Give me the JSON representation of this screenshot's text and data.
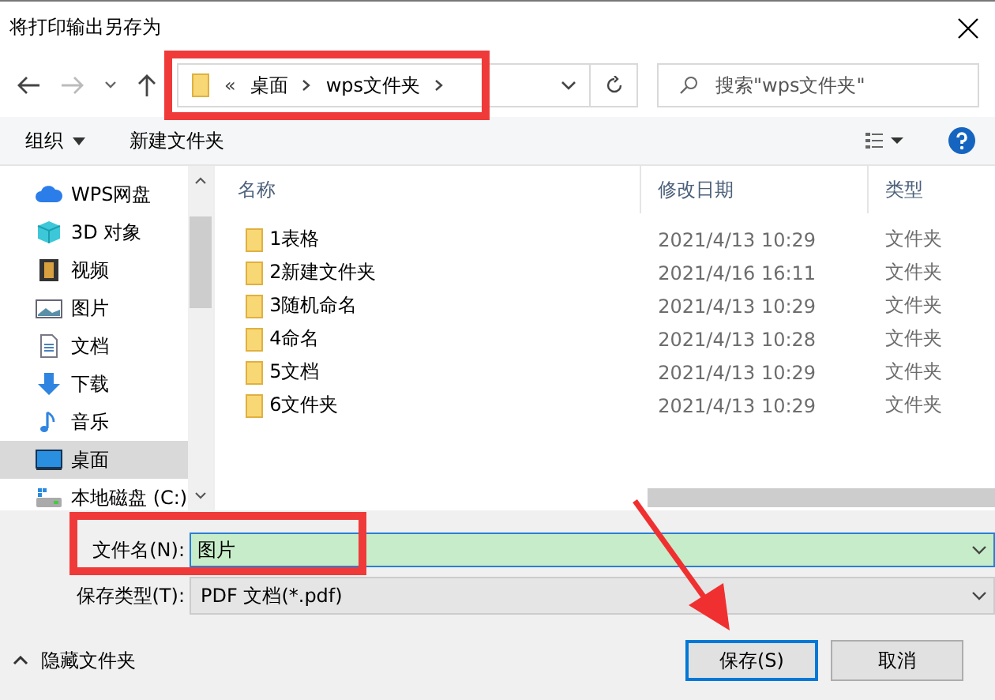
{
  "window": {
    "title": "将打印输出另存为"
  },
  "address": {
    "overflow": "«",
    "path": [
      "桌面",
      "wps文件夹"
    ]
  },
  "search": {
    "placeholder": "搜索\"wps文件夹\""
  },
  "toolbar": {
    "organize": "组织",
    "new_folder": "新建文件夹"
  },
  "sidebar": {
    "items": [
      {
        "label": "WPS网盘",
        "kind": "cloud",
        "selected": false
      },
      {
        "label": "3D 对象",
        "kind": "cube",
        "selected": false
      },
      {
        "label": "视频",
        "kind": "video",
        "selected": false
      },
      {
        "label": "图片",
        "kind": "picture",
        "selected": false
      },
      {
        "label": "文档",
        "kind": "document",
        "selected": false
      },
      {
        "label": "下载",
        "kind": "download",
        "selected": false
      },
      {
        "label": "音乐",
        "kind": "music",
        "selected": false
      },
      {
        "label": "桌面",
        "kind": "desktop",
        "selected": true
      },
      {
        "label": "本地磁盘 (C:)",
        "kind": "drive",
        "selected": false
      }
    ]
  },
  "table": {
    "columns": [
      "名称",
      "修改日期",
      "类型"
    ],
    "rows": [
      {
        "name": "1表格",
        "date": "2021/4/13 10:29",
        "type": "文件夹"
      },
      {
        "name": "2新建文件夹",
        "date": "2021/4/16 16:11",
        "type": "文件夹"
      },
      {
        "name": "3随机命名",
        "date": "2021/4/13 10:29",
        "type": "文件夹"
      },
      {
        "name": "4命名",
        "date": "2021/4/13 10:28",
        "type": "文件夹"
      },
      {
        "name": "5文档",
        "date": "2021/4/13 10:29",
        "type": "文件夹"
      },
      {
        "name": "6文件夹",
        "date": "2021/4/13 10:29",
        "type": "文件夹"
      }
    ]
  },
  "form": {
    "filename_label": "文件名(N):",
    "filename": "图片",
    "type_label": "保存类型(T):",
    "type": "PDF 文档(*.pdf)"
  },
  "hide_folders": "隐藏文件夹",
  "buttons": [
    {
      "label": "保存(S)",
      "default": true
    },
    {
      "label": "取消",
      "default": false
    }
  ]
}
